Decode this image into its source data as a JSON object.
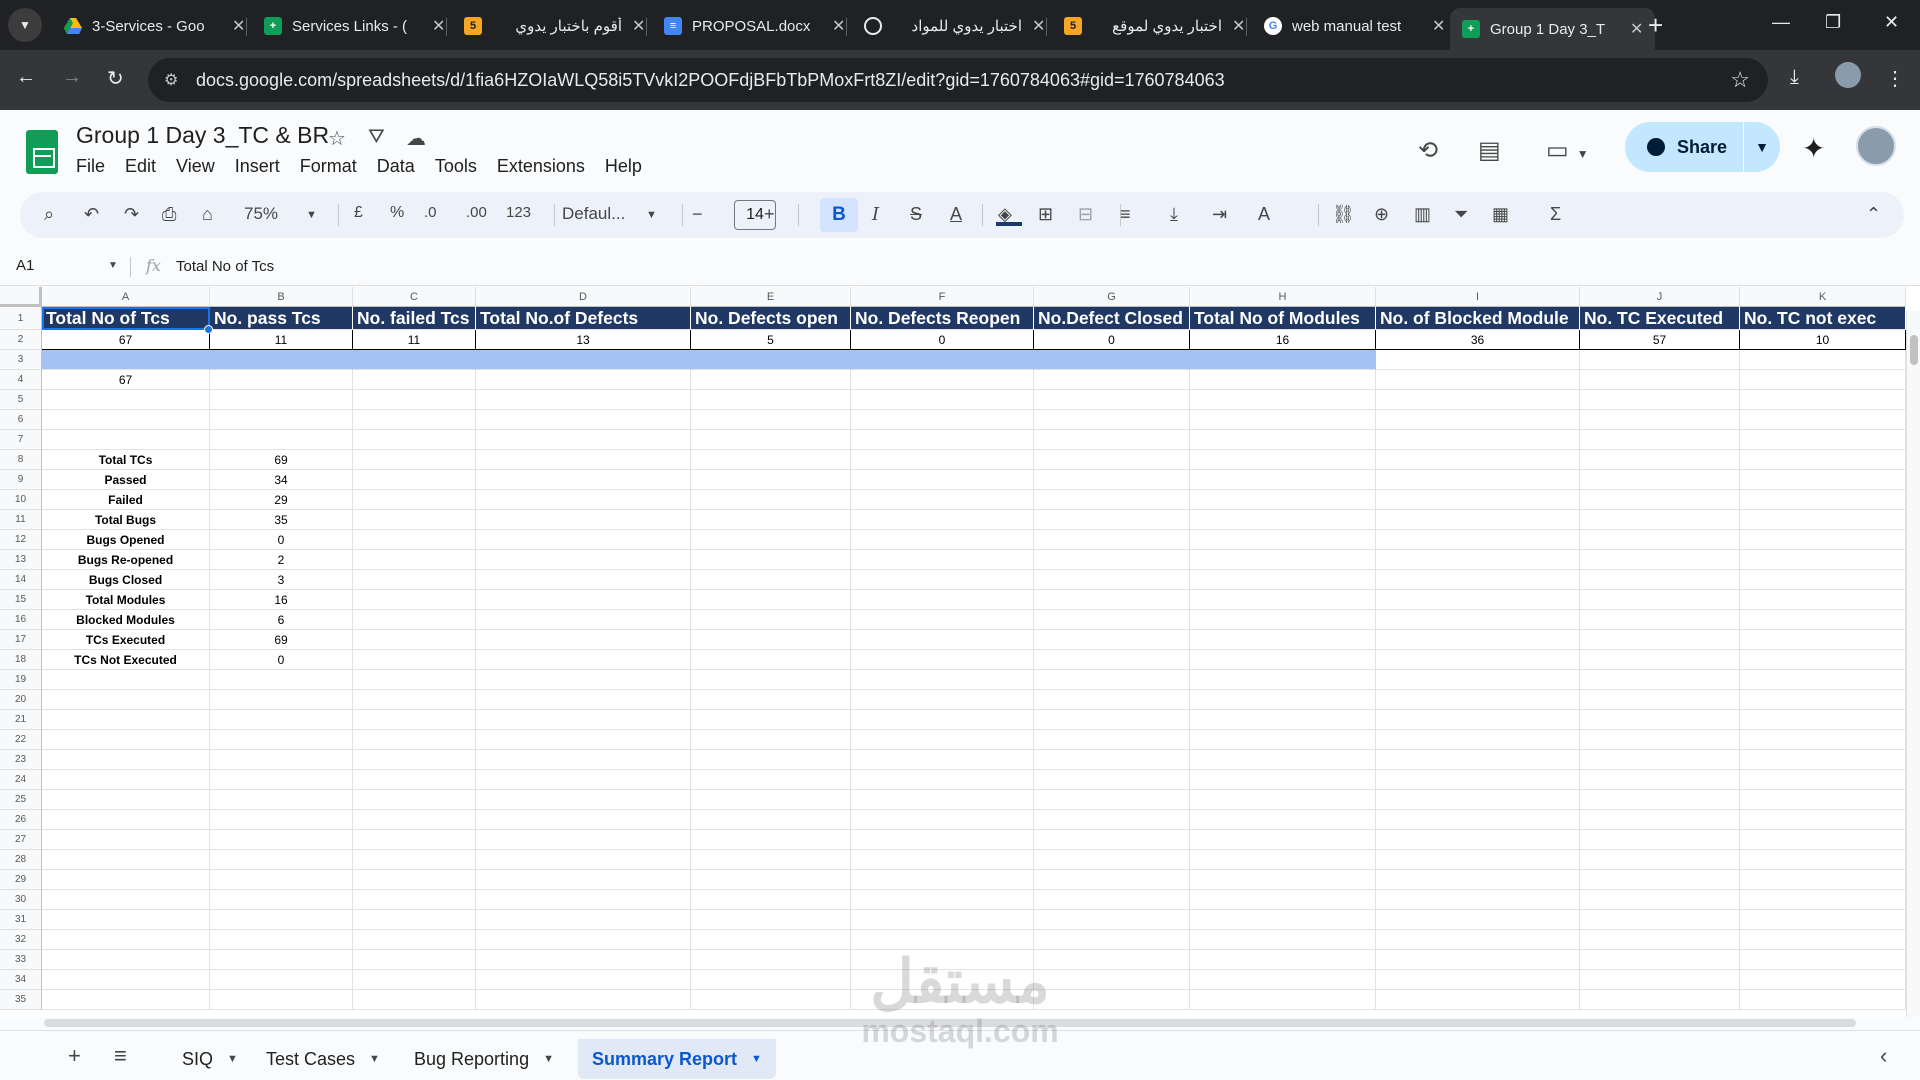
{
  "browser": {
    "tabs": [
      {
        "title": "3-Services - Goo",
        "icon": "drive-icon",
        "color": "#fbbc04"
      },
      {
        "title": "Services Links - (",
        "icon": "sheets-icon",
        "color": "#0f9d58"
      },
      {
        "title": "أقوم باختبار يدوي",
        "icon": "khamsat-icon",
        "color": "#f5a623"
      },
      {
        "title": "PROPOSAL.docx",
        "icon": "docs-icon",
        "color": "#4285f4"
      },
      {
        "title": "اختبار يدوي للمواد",
        "icon": "chatgpt-icon",
        "color": "#e8eaed"
      },
      {
        "title": "اختبار يدوي لموقع",
        "icon": "khamsat-icon",
        "color": "#f5a623"
      },
      {
        "title": "web manual test",
        "icon": "google-icon",
        "color": "#ffffff"
      },
      {
        "title": "Group 1 Day 3_T",
        "icon": "sheets-icon",
        "color": "#0f9d58"
      }
    ],
    "url": "docs.google.com/spreadsheets/d/1fia6HZOIaWLQ58i5TVvkI2POOFdjBFbTbPMoxFrt8ZI/edit?gid=1760784063#gid=1760784063"
  },
  "doc": {
    "title": "Group 1 Day 3_TC & BR",
    "menu": [
      "File",
      "Edit",
      "View",
      "Insert",
      "Format",
      "Data",
      "Tools",
      "Extensions",
      "Help"
    ],
    "share_label": "Share"
  },
  "toolbar": {
    "zoom": "75%",
    "currency": "£",
    "percent": "%",
    "dec_decrease": ".0",
    "dec_increase": ".00",
    "number_format": "123",
    "font": "Defaul...",
    "font_size": "14"
  },
  "formula": {
    "cell_ref": "A1",
    "content": "Total No of Tcs"
  },
  "sheet": {
    "columns": [
      "A",
      "B",
      "C",
      "D",
      "E",
      "F",
      "G",
      "H",
      "I",
      "J",
      "K"
    ],
    "header_row": [
      "Total No of Tcs",
      "No. pass Tcs",
      "No. failed Tcs",
      "Total No.of Defects",
      "No. Defects open",
      "No. Defects Reopen",
      "No.Defect Closed",
      "Total No of Modules",
      "No. of Blocked Module",
      "No. TC Executed",
      "No. TC not exec"
    ],
    "value_row": [
      "67",
      "11",
      "11",
      "13",
      "5",
      "0",
      "0",
      "16",
      "36",
      "57",
      "10"
    ],
    "a4_value": "67",
    "summary": [
      {
        "label": "Total TCs",
        "value": "69"
      },
      {
        "label": "Passed",
        "value": "34"
      },
      {
        "label": "Failed",
        "value": "29"
      },
      {
        "label": "Total Bugs",
        "value": "35"
      },
      {
        "label": "Bugs Opened",
        "value": "0"
      },
      {
        "label": "Bugs Re-opened",
        "value": "2"
      },
      {
        "label": "Bugs Closed",
        "value": "3"
      },
      {
        "label": "Total Modules",
        "value": "16"
      },
      {
        "label": "Blocked Modules",
        "value": "6"
      },
      {
        "label": "TCs Executed",
        "value": "69"
      },
      {
        "label": "TCs Not Executed",
        "value": "0"
      }
    ]
  },
  "sheet_tabs": [
    "SIQ",
    "Test Cases",
    "Bug Reporting",
    "Summary Report"
  ],
  "active_sheet": "Summary Report",
  "watermark": {
    "arabic": "مستقل",
    "latin": "mostaql.com"
  },
  "colors": {
    "header_fill": "#1f3864",
    "blue_fill": "#a4c2f4",
    "accent": "#0b57d0"
  }
}
